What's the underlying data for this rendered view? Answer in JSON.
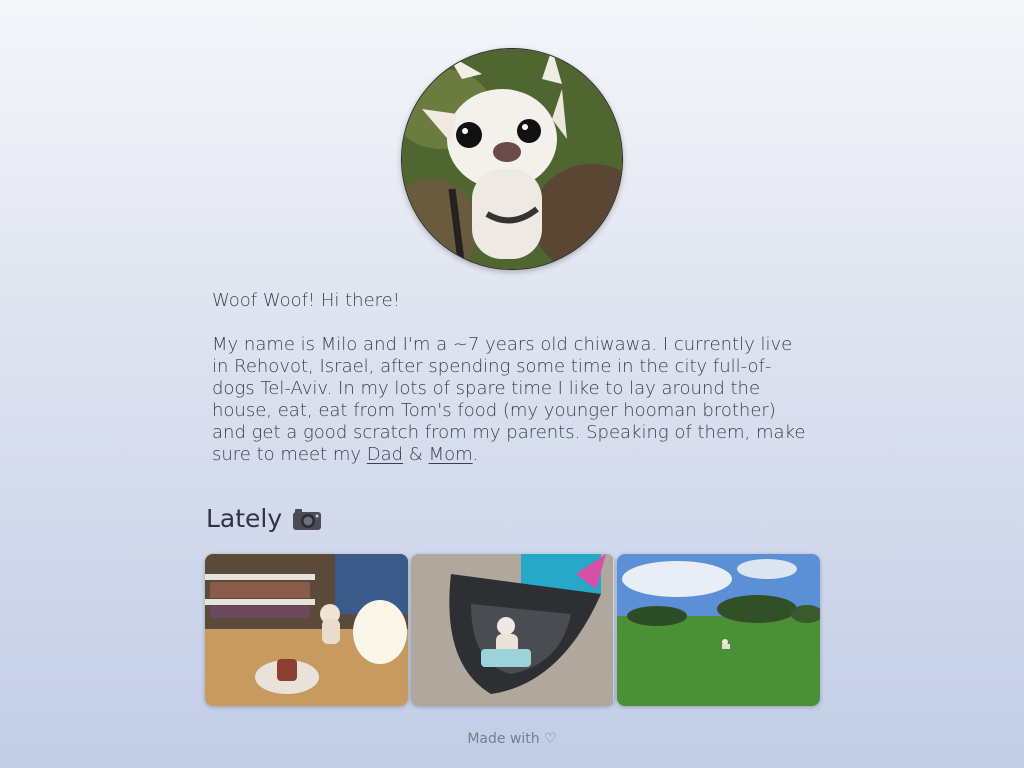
{
  "profile": {
    "avatar_alt": "Milo the chihuahua"
  },
  "intro": {
    "greeting": "Woof Woof! Hi there!",
    "bio_text": "My name is Milo and I'm a ~7 years old chiwawa. I currently live in Rehovot, Israel, after spending some time in the city full-of-dogs Tel-Aviv. In my lots of spare time I like to lay around the house, eat, eat from Tom's food (my younger hooman brother) and get a good scratch from my parents. Speaking of them, make sure to meet my ",
    "dad_link": "Dad",
    "amp": " & ",
    "mom_link": "Mom",
    "period": "."
  },
  "lately": {
    "title": "Lately",
    "icon": "camera-icon"
  },
  "gallery": {
    "photos": [
      {
        "alt": "Milo at home next to a lamp"
      },
      {
        "alt": "Milo in a stroller"
      },
      {
        "alt": "Milo in a park"
      }
    ]
  },
  "footer": {
    "text": "Made with ♡"
  }
}
